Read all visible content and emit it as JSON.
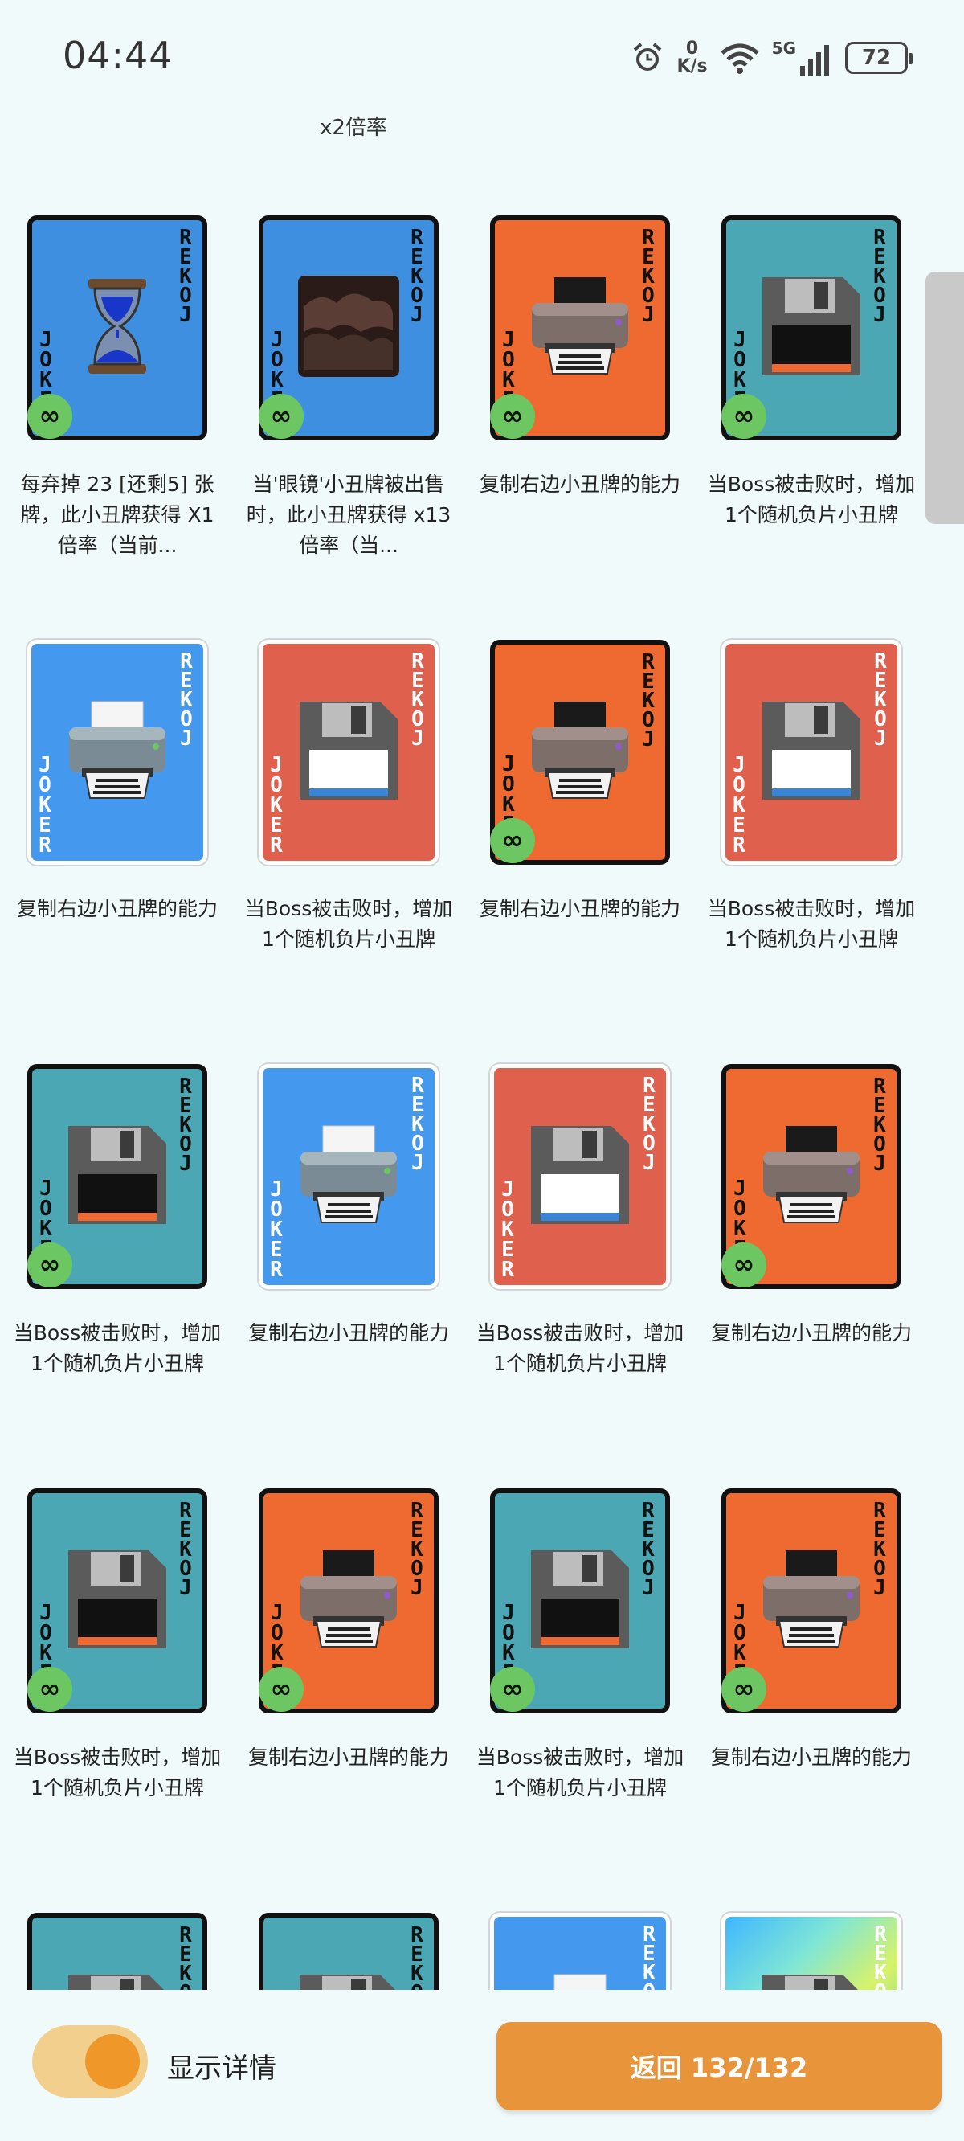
{
  "status": {
    "time": "04:44",
    "net_speed_value": "0",
    "net_speed_unit": "K/s",
    "signal_label": "5G",
    "battery": "72"
  },
  "header": {
    "multiplier": "x2倍率"
  },
  "card_corner_text": "JOKER",
  "colors": {
    "blue": "#3f8fe0",
    "orange": "#ef6a30",
    "teal": "#4ba7b4",
    "red": "#e0604e",
    "rainbow": "rainbow"
  },
  "cards": [
    {
      "color": "#3f8fe0",
      "style": "dark",
      "icon": "hourglass-icon",
      "infinite": true,
      "desc": "每弃掉 23 [还剩5] 张牌，此小丑牌获得 X1倍率（当前..."
    },
    {
      "color": "#3f8fe0",
      "style": "dark",
      "icon": "cloud-image-icon",
      "infinite": true,
      "desc": "当'眼镜'小丑牌被出售时，此小丑牌获得 x13倍率（当..."
    },
    {
      "color": "#ef6a30",
      "style": "dark",
      "icon": "printer-icon",
      "infinite": true,
      "desc": "复制右边小丑牌的能力"
    },
    {
      "color": "#4ba7b4",
      "style": "dark",
      "icon": "floppy-disk-icon",
      "infinite": true,
      "desc": "当Boss被击败时，增加1个随机负片小丑牌"
    },
    {
      "color": "#4499ee",
      "style": "light",
      "icon": "printer-icon",
      "infinite": false,
      "desc": "复制右边小丑牌的能力"
    },
    {
      "color": "#e0604e",
      "style": "light",
      "icon": "floppy-disk-icon",
      "infinite": false,
      "desc": "当Boss被击败时，增加1个随机负片小丑牌"
    },
    {
      "color": "#ef6a30",
      "style": "dark",
      "icon": "printer-icon",
      "infinite": true,
      "desc": "复制右边小丑牌的能力"
    },
    {
      "color": "#e0604e",
      "style": "light",
      "icon": "floppy-disk-icon",
      "infinite": false,
      "desc": "当Boss被击败时，增加1个随机负片小丑牌"
    },
    {
      "color": "#4ba7b4",
      "style": "dark",
      "icon": "floppy-disk-icon",
      "infinite": true,
      "desc": "当Boss被击败时，增加1个随机负片小丑牌"
    },
    {
      "color": "#4499ee",
      "style": "light",
      "icon": "printer-icon",
      "infinite": false,
      "desc": "复制右边小丑牌的能力"
    },
    {
      "color": "#e0604e",
      "style": "light",
      "icon": "floppy-disk-icon",
      "infinite": false,
      "desc": "当Boss被击败时，增加1个随机负片小丑牌"
    },
    {
      "color": "#ef6a30",
      "style": "dark",
      "icon": "printer-icon",
      "infinite": true,
      "desc": "复制右边小丑牌的能力"
    },
    {
      "color": "#4ba7b4",
      "style": "dark",
      "icon": "floppy-disk-icon",
      "infinite": true,
      "desc": "当Boss被击败时，增加1个随机负片小丑牌"
    },
    {
      "color": "#ef6a30",
      "style": "dark",
      "icon": "printer-icon",
      "infinite": true,
      "desc": "复制右边小丑牌的能力"
    },
    {
      "color": "#4ba7b4",
      "style": "dark",
      "icon": "floppy-disk-icon",
      "infinite": true,
      "desc": "当Boss被击败时，增加1个随机负片小丑牌"
    },
    {
      "color": "#ef6a30",
      "style": "dark",
      "icon": "printer-icon",
      "infinite": true,
      "desc": "复制右边小丑牌的能力"
    },
    {
      "color": "#4ba7b4",
      "style": "dark",
      "icon": "floppy-disk-icon",
      "infinite": false,
      "desc": ""
    },
    {
      "color": "#4ba7b4",
      "style": "dark",
      "icon": "floppy-disk-icon",
      "infinite": false,
      "desc": ""
    },
    {
      "color": "#4499ee",
      "style": "light",
      "icon": "printer-icon",
      "infinite": false,
      "desc": ""
    },
    {
      "color": "rainbow",
      "style": "light",
      "icon": "floppy-disk-icon",
      "infinite": false,
      "desc": ""
    }
  ],
  "footer": {
    "toggle_label": "显示详情",
    "toggle_on": true,
    "return_label": "返回 132/132"
  }
}
